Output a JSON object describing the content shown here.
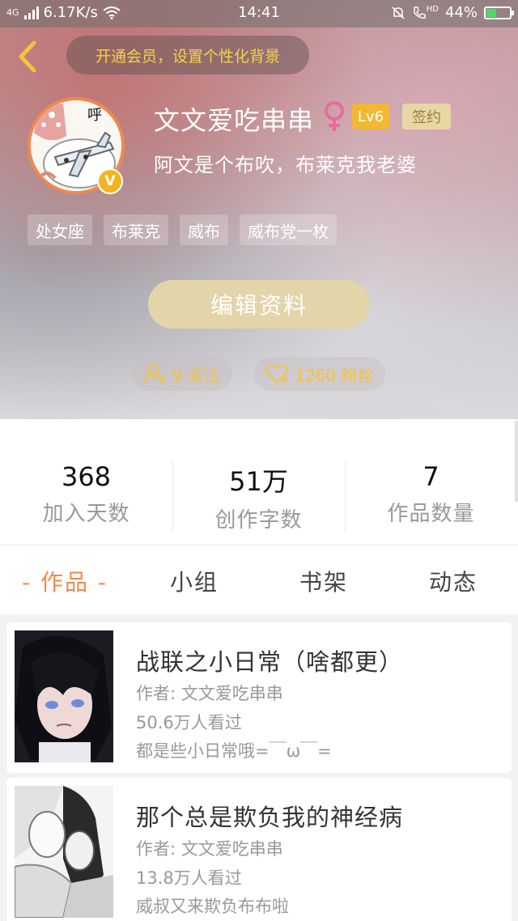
{
  "status": {
    "network": "6.17K/s",
    "signal_label": "4G",
    "time": "14:41",
    "hd": "HD",
    "battery": "44%",
    "battery_level": 0.44
  },
  "header": {
    "vip_banner": "开通会员，设置个性化背景",
    "username": "文文爱吃串串",
    "level": "Lv6",
    "sign_badge": "签约",
    "bio": "阿文是个布吹，布莱克我老婆",
    "avatar_text": "呼",
    "avatar_badge": "V",
    "tags": [
      "处女座",
      "布莱克",
      "威布",
      "威布党一枚"
    ],
    "edit_button": "编辑资料",
    "follow": "9 关注",
    "fans": "1260 粉丝"
  },
  "stats": [
    {
      "value": "368",
      "label": "加入天数"
    },
    {
      "value": "51万",
      "label": "创作字数"
    },
    {
      "value": "7",
      "label": "作品数量"
    }
  ],
  "tabs": [
    "- 作品 -",
    "小组",
    "书架",
    "动态"
  ],
  "works": [
    {
      "title": "战联之小日常（啥都更）",
      "author": "作者: 文文爱吃串串",
      "views": "50.6万人看过",
      "desc": "都是些小日常哦=￣ω￣="
    },
    {
      "title": "那个总是欺负我的神经病",
      "author": "作者: 文文爱吃串串",
      "views": "13.8万人看过",
      "desc": "威叔又来欺负布布啦"
    }
  ],
  "colors": {
    "accent": "#f08a4b",
    "gold": "#f6c23c",
    "level_badge": "#f2b834",
    "sign_badge": "#e8d7a6"
  }
}
